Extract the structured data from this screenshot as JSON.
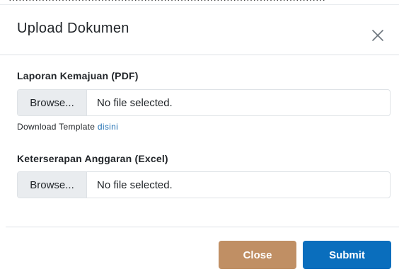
{
  "modal": {
    "title": "Upload Dokumen",
    "close_icon": "close-icon"
  },
  "fields": [
    {
      "label": "Laporan Kemajuan (PDF)",
      "browse_label": "Browse...",
      "status": "No file selected."
    },
    {
      "label": "Keterserapan Anggaran (Excel)",
      "browse_label": "Browse...",
      "status": "No file selected."
    }
  ],
  "download": {
    "text": "Download Template ",
    "link": "disini",
    "link_color": "#1f6fb2"
  },
  "footer": {
    "close_label": "Close",
    "submit_label": "Submit",
    "close_color": "#c08f64",
    "submit_color": "#0a6ebd"
  }
}
